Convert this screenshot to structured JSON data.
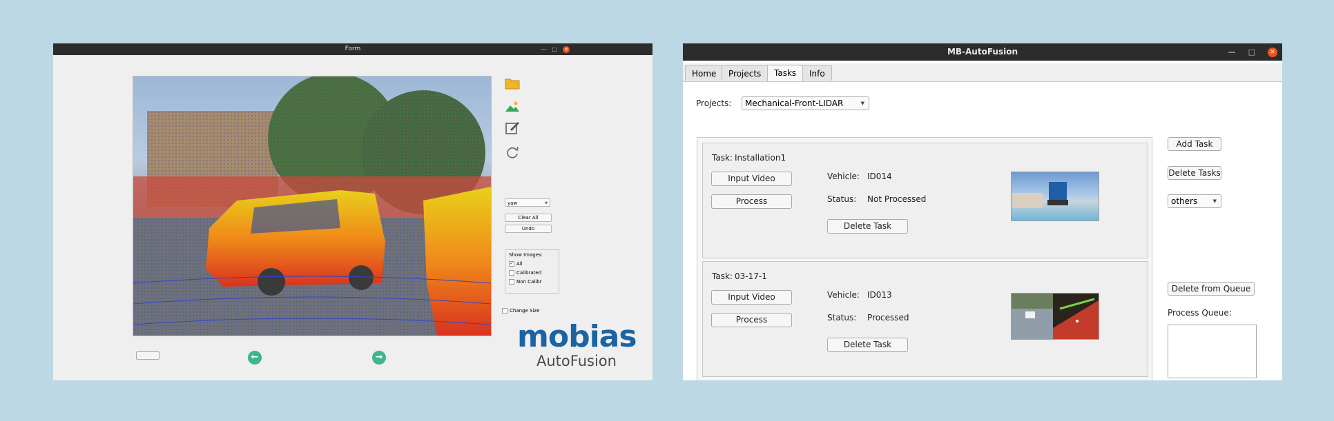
{
  "left_window": {
    "title": "Form",
    "icons": [
      "folder-icon",
      "image-icon",
      "edit-image-icon",
      "refresh-icon"
    ],
    "axis_select_value": "yaw",
    "clear_all_label": "Clear All",
    "undo_label": "Undo",
    "show_images": {
      "title": "Show Images:",
      "options": [
        {
          "label": "All",
          "checked": true
        },
        {
          "label": "Calibrated",
          "checked": false
        },
        {
          "label": "Non Calibr",
          "checked": false
        }
      ]
    },
    "change_size_label": "Change Size",
    "prev_arrow": "←",
    "next_arrow": "→",
    "logo": {
      "word": "mobias",
      "sub": "AutoFusion"
    }
  },
  "right_window": {
    "title": "MB-AutoFusion",
    "tabs": [
      {
        "label": "Home",
        "active": false
      },
      {
        "label": "Projects",
        "active": false
      },
      {
        "label": "Tasks",
        "active": true
      },
      {
        "label": "Info",
        "active": false
      }
    ],
    "projects_label": "Projects:",
    "project_value": "Mechanical-Front-LIDAR",
    "tasks": [
      {
        "task_label": "Task:",
        "task_name": "Installation1",
        "input_video_label": "Input Video",
        "process_label": "Process",
        "vehicle_label": "Vehicle:",
        "vehicle_value": "ID014",
        "status_label": "Status:",
        "status_value": "Not Processed",
        "delete_label": "Delete Task"
      },
      {
        "task_label": "Task:",
        "task_name": "03-17-1",
        "input_video_label": "Input Video",
        "process_label": "Process",
        "vehicle_label": "Vehicle:",
        "vehicle_value": "ID013",
        "status_label": "Status:",
        "status_value": "Processed",
        "delete_label": "Delete Task"
      }
    ],
    "add_task_label": "Add Task",
    "delete_tasks_label": "Delete Tasks",
    "filter_value": "others",
    "delete_from_queue_label": "Delete from Queue",
    "process_queue_label": "Process Queue:"
  },
  "colors": {
    "background": "#bcd8e4",
    "titlebar": "#2c2c2c",
    "close_button": "#e95420",
    "nav_arrow": "#3fb58a",
    "logo_blue": "#1c63a3"
  }
}
